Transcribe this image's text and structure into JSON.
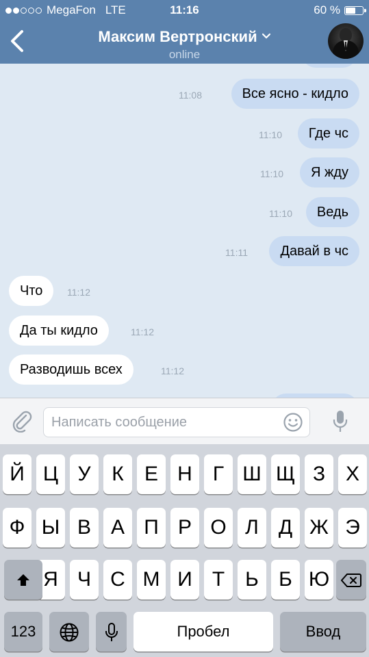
{
  "status_bar": {
    "carrier": "MegaFon",
    "network": "LTE",
    "time": "11:16",
    "battery": "60 %",
    "battery_level": 0.6,
    "signal_bars_filled": 2,
    "signal_bars_total": 5
  },
  "header": {
    "contact_name": "Максим Вертронский",
    "status": "online",
    "header_color": "#5b82ad"
  },
  "messages": [
    {
      "direction": "out",
      "text": "Все ясно - кидло",
      "time": "11:08"
    },
    {
      "direction": "out",
      "text": "Где чс",
      "time": "11:10"
    },
    {
      "direction": "out",
      "text": "Я жду",
      "time": "11:10"
    },
    {
      "direction": "out",
      "text": "Ведь",
      "time": "11:10"
    },
    {
      "direction": "out",
      "text": "Давай в чс",
      "time": "11:11"
    },
    {
      "direction": "in",
      "text": "Что",
      "time": "11:12"
    },
    {
      "direction": "in",
      "text": "Да ты кидло",
      "time": "11:12"
    },
    {
      "direction": "in",
      "text": "Разводишь всех",
      "time": "11:12"
    }
  ],
  "composer": {
    "placeholder": "Написать сообщение",
    "icons": [
      "attach-icon",
      "emoji-icon",
      "microphone-icon"
    ]
  },
  "keyboard": {
    "row1": [
      "Й",
      "Ц",
      "У",
      "К",
      "Е",
      "Н",
      "Г",
      "Ш",
      "Щ",
      "З",
      "Х"
    ],
    "row2": [
      "Ф",
      "Ы",
      "В",
      "А",
      "П",
      "Р",
      "О",
      "Л",
      "Д",
      "Ж",
      "Э"
    ],
    "row3": [
      "Я",
      "Ч",
      "С",
      "М",
      "И",
      "Т",
      "Ь",
      "Б",
      "Ю"
    ],
    "numbers_label": "123",
    "space_label": "Пробел",
    "return_label": "Ввод",
    "icons": [
      "shift-icon",
      "backspace-icon",
      "globe-icon",
      "dictation-icon"
    ]
  }
}
